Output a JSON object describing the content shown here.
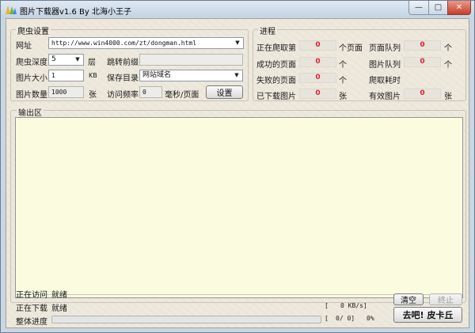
{
  "window": {
    "title": "图片下载器v1.6 By 北海小王子",
    "minimize": "—",
    "maximize": "□",
    "close": "✕"
  },
  "crawler": {
    "group_title": "爬虫设置",
    "url_label": "网址",
    "url_value": "http://www.win4000.com/zt/dongman.html",
    "depth_label": "爬虫深度",
    "depth_value": "5",
    "depth_unit": "层",
    "jump_prefix_label": "跳转前缀",
    "jump_prefix_value": "",
    "size_label": "图片大小",
    "size_value": "1",
    "size_unit": "KB",
    "save_dir_label": "保存目录",
    "save_dir_value": "网站域名",
    "count_label": "图片数量",
    "count_value": "1000",
    "count_unit": "张",
    "freq_label": "访问频率",
    "freq_value": "0",
    "freq_unit": "毫秒/页面",
    "settings_button": "设置"
  },
  "progress": {
    "group_title": "进程",
    "crawling_label": "正在爬取第",
    "crawling_value": "0",
    "crawling_unit": "个页面",
    "page_queue_label": "页面队列",
    "page_queue_value": "0",
    "page_queue_unit": "个",
    "success_label": "成功的页面",
    "success_value": "0",
    "success_unit": "个",
    "image_queue_label": "图片队列",
    "image_queue_value": "0",
    "image_queue_unit": "个",
    "failed_label": "失败的页面",
    "failed_value": "0",
    "failed_unit": "个",
    "elapsed_label": "爬取耗时",
    "downloaded_label": "已下载图片",
    "downloaded_value": "0",
    "downloaded_unit": "张",
    "valid_label": "有效图片",
    "valid_value": "0",
    "valid_unit": "张"
  },
  "output": {
    "label": "输出区"
  },
  "status": {
    "visiting_label": "正在访问",
    "visiting_value": "就绪",
    "downloading_label": "正在下载",
    "downloading_value": "就绪",
    "overall_label": "整体进度",
    "speed_open": "[",
    "speed_value": "0 KB/s]",
    "count_open": "[",
    "count_value": "0/ 0]",
    "percent": "0%",
    "overall_progress": 0,
    "clear_button": "清空",
    "stop_button": "终止",
    "start_button": "去吧! 皮卡丘"
  }
}
